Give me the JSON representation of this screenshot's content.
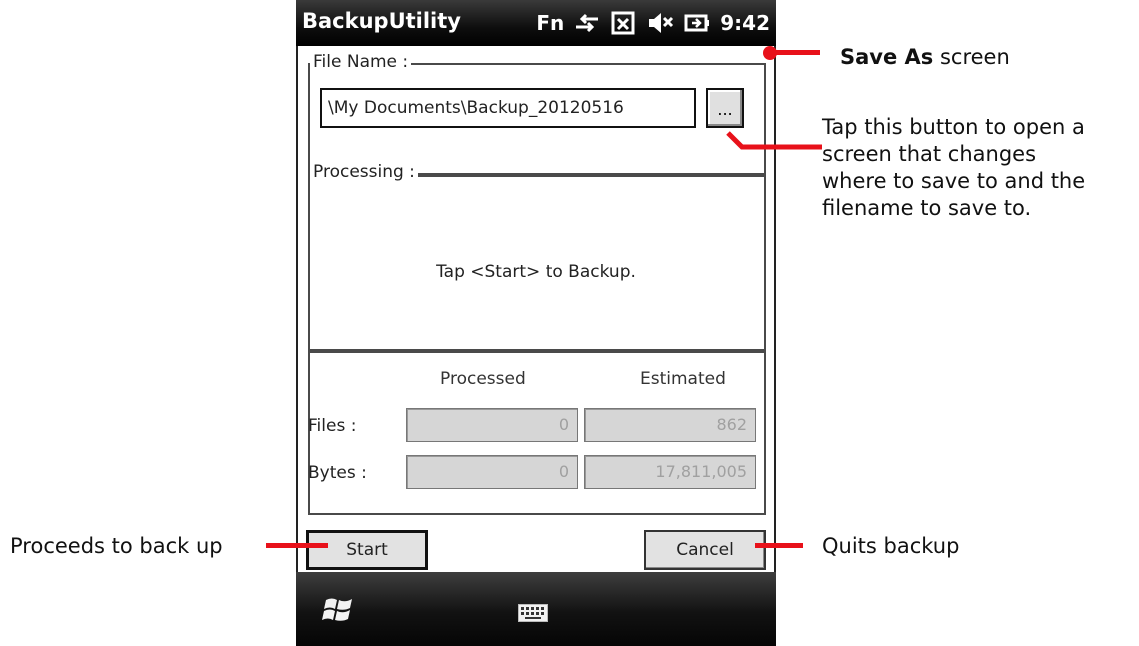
{
  "device": {
    "app_title": "BackupUtility",
    "status": {
      "fn_label": "Fn",
      "time": "9:42",
      "icons": [
        "connectivity-icon",
        "signal-off-icon",
        "speaker-mute-icon",
        "battery-charging-icon"
      ]
    }
  },
  "file_name_group": {
    "label": "File Name :",
    "value": "\\My Documents\\Backup_20120516",
    "browse_label": "..."
  },
  "processing_group": {
    "label": "Processing :",
    "message": "Tap <Start> to Backup."
  },
  "stats": {
    "headers": [
      "Processed",
      "Estimated"
    ],
    "rows": [
      {
        "label": "Files :",
        "processed": "0",
        "estimated": "862"
      },
      {
        "label": "Bytes :",
        "processed": "0",
        "estimated": "17,811,005"
      }
    ]
  },
  "buttons": {
    "start": "Start",
    "cancel": "Cancel"
  },
  "taskbar": {
    "icons": [
      "windows-start-icon",
      "keyboard-icon"
    ]
  },
  "annotations": {
    "save_as_bold": "Save As",
    "save_as_rest": " screen",
    "browse_note": [
      "Tap this button to open a",
      "screen that changes",
      "where to save to and the",
      "filename to save to."
    ],
    "start_note": "Proceeds to back up",
    "cancel_note": "Quits backup"
  },
  "colors": {
    "annotation_red": "#e8111a",
    "titlebar": "#000000",
    "control_gray": "#d6d6d6"
  }
}
